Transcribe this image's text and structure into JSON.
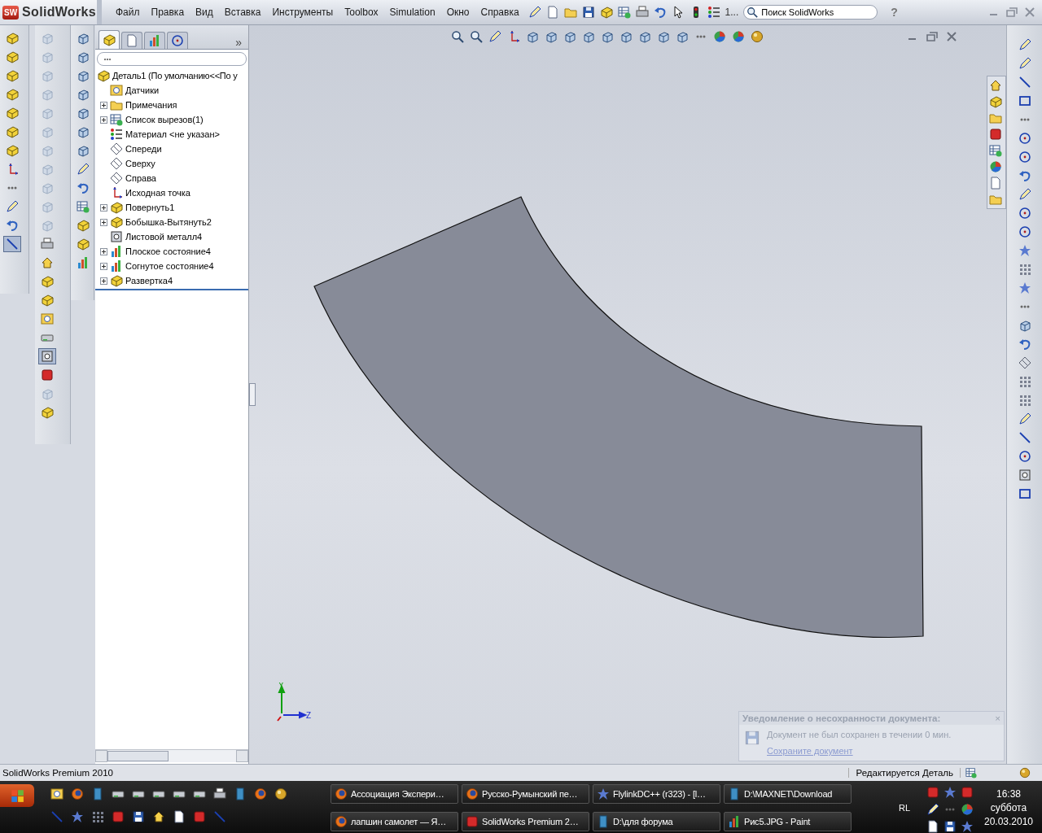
{
  "app": {
    "badge": "SW",
    "title": "SolidWorks"
  },
  "menu": [
    "Файл",
    "Правка",
    "Вид",
    "Вставка",
    "Инструменты",
    "Toolbox",
    "Simulation",
    "Окно",
    "Справка"
  ],
  "toolbar": {
    "more": "1...",
    "search": {
      "placeholder": "Поиск SolidWorks"
    },
    "help": "?"
  },
  "command_toolbars": [
    [
      {
        "selected": false
      },
      {
        "selected": false
      },
      {
        "selected": false
      },
      {
        "selected": false
      },
      {
        "selected": false
      },
      {
        "selected": false
      },
      {
        "selected": false
      },
      {
        "selected": false
      },
      {
        "selected": false
      },
      {
        "selected": false
      },
      {
        "selected": false
      },
      {
        "selected": true
      }
    ],
    [
      {
        "selected": false
      },
      {
        "selected": false
      },
      {
        "selected": false
      },
      {
        "selected": false
      },
      {
        "selected": false
      },
      {
        "selected": false
      },
      {
        "selected": false
      },
      {
        "selected": false
      },
      {
        "selected": false
      },
      {
        "selected": false
      },
      {
        "selected": false
      },
      {
        "selected": false
      },
      {
        "selected": false
      },
      {
        "selected": false
      },
      {
        "selected": false
      },
      {
        "selected": false
      },
      {
        "selected": false
      },
      {
        "selected": true
      },
      {
        "selected": false
      },
      {
        "selected": false
      },
      {
        "selected": false
      }
    ],
    [
      {
        "selected": false
      },
      {
        "selected": false
      },
      {
        "selected": false
      },
      {
        "selected": false
      },
      {
        "selected": false
      },
      {
        "selected": false
      },
      {
        "selected": false
      },
      {
        "selected": false
      },
      {
        "selected": false
      },
      {
        "selected": false
      },
      {
        "selected": false
      },
      {
        "selected": false
      },
      {
        "selected": false
      }
    ]
  ],
  "feature_tree": {
    "tabs": [
      {
        "selected": true
      },
      {
        "selected": false
      },
      {
        "selected": false
      },
      {
        "selected": false
      }
    ],
    "more": "»",
    "root": "Деталь1  (По умолчанию<<По у",
    "items": [
      {
        "label": "Датчики",
        "collapsed": false
      },
      {
        "label": "Примечания",
        "collapsed": true
      },
      {
        "label": "Список вырезов(1)",
        "collapsed": true
      },
      {
        "label": "Материал <не указан>",
        "collapsed": false
      },
      {
        "label": "Спереди",
        "collapsed": false
      },
      {
        "label": "Сверху",
        "collapsed": false
      },
      {
        "label": "Справа",
        "collapsed": false
      },
      {
        "label": "Исходная точка",
        "collapsed": false
      },
      {
        "label": "Повернуть1",
        "collapsed": true
      },
      {
        "label": "Бобышка-Вытянуть2",
        "collapsed": true
      },
      {
        "label": "Листовой металл4",
        "collapsed": false
      },
      {
        "label": "Плоское состояние4",
        "collapsed": true
      },
      {
        "label": "Согнутое состояние4",
        "collapsed": true
      },
      {
        "label": "Развертка4",
        "collapsed": true
      }
    ]
  },
  "viewport": {
    "triad": {
      "y": "Y",
      "z": "Z"
    }
  },
  "notification": {
    "title": "Уведомление о несохранности документа:",
    "close": "×",
    "message": "Документ не был сохранен в течении 0 мин.",
    "link": "Сохраните документ"
  },
  "status_bar": {
    "product": "SolidWorks Premium 2010",
    "mode": "Редактируется Деталь"
  },
  "taskbar": {
    "tasks": [
      {
        "label": "Ассоциация Экспери…"
      },
      {
        "label": "Русско-Румынский пе…"
      },
      {
        "label": "FlylinkDC++ (r323) - [l…"
      },
      {
        "label": "D:\\MAXNET\\Download"
      },
      {
        "label": "лапшин самолет — Я…"
      },
      {
        "label": "SolidWorks Premium 2…"
      },
      {
        "label": "D:\\для форума"
      },
      {
        "label": "Рис5.JPG - Paint"
      }
    ],
    "language": "RL",
    "clock": {
      "time": "16:38",
      "day": "суббота",
      "date": "20.03.2010"
    }
  }
}
